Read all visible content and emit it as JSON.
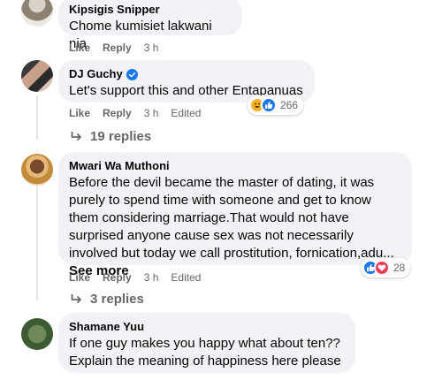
{
  "comments": [
    {
      "author": "Kipsigis Snipper",
      "text": "Chome kumisiet lakwani nia",
      "actions": {
        "like": "Like",
        "reply": "Reply",
        "time": "3 h"
      }
    },
    {
      "author": "DJ Guchy",
      "verified": true,
      "text": "Let's support this and other Entapanuas",
      "actions": {
        "like": "Like",
        "reply": "Reply",
        "time": "3 h",
        "edited": "Edited"
      },
      "reaction_count": "266",
      "replies_label": "19 replies"
    },
    {
      "author": "Mwari Wa Muthoni",
      "text": "Before the devil became the master of dating, it was purely to spend time with someone and get to know them considering marriage.That would not have surprised anyone cause sex was not necessarily involved but today we call prostitution, fornication,adu...",
      "see_more": "See more",
      "actions": {
        "like": "Like",
        "reply": "Reply",
        "time": "3 h",
        "edited": "Edited"
      },
      "reaction_count": "28",
      "replies_label": "3 replies"
    },
    {
      "author": "Shamane Yuu",
      "text": "If one guy makes you happy what about ten?? Explain the meaning of happiness here please"
    }
  ],
  "colors": {
    "bubble": "#f0f2f5",
    "secondary_text": "#65676b",
    "like_blue": "#1877f2",
    "love_red": "#f33e58",
    "haha_yellow": "#f7b125"
  },
  "icons": {
    "reply_arrow": "reply-arrow-icon",
    "verified": "verified-badge-icon",
    "like": "like-reaction-icon",
    "love": "love-reaction-icon",
    "haha": "haha-reaction-icon"
  }
}
